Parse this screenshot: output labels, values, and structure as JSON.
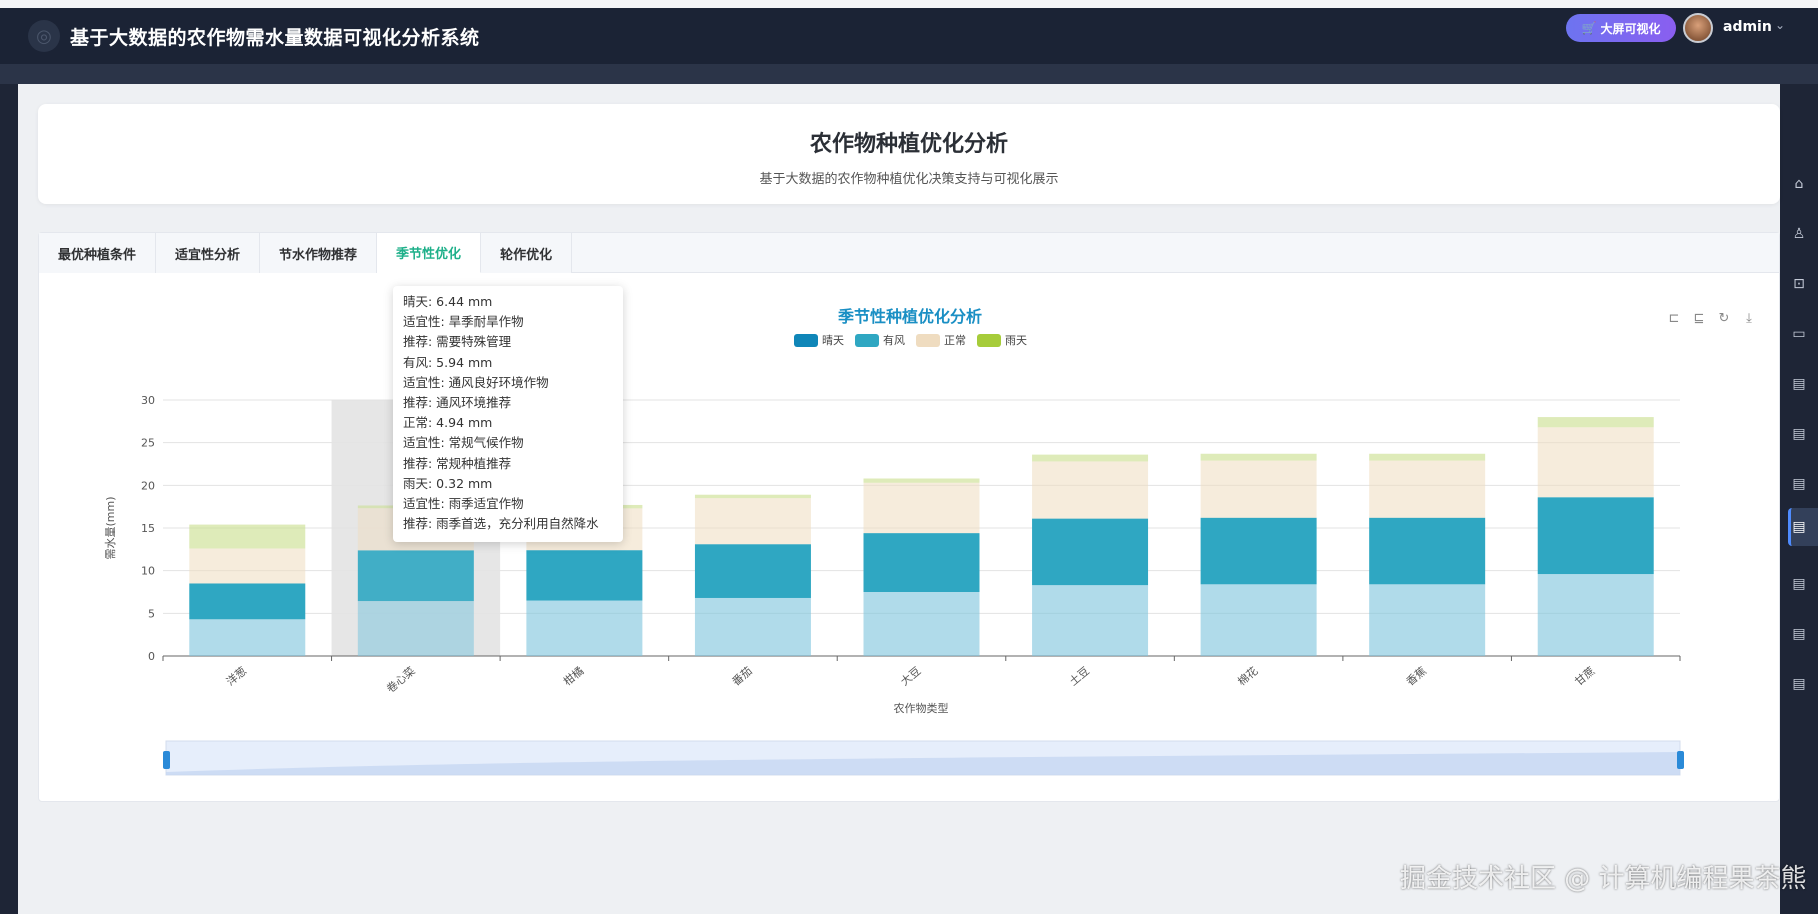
{
  "header": {
    "title": "基于大数据的农作物需水量数据可视化分析系统",
    "big_screen_label": "大屏可视化",
    "user_name": "admin"
  },
  "page": {
    "title": "农作物种植优化分析",
    "subtitle": "基于大数据的农作物种植优化决策支持与可视化展示"
  },
  "tabs": [
    {
      "label": "最优种植条件"
    },
    {
      "label": "适宜性分析"
    },
    {
      "label": "节水作物推荐"
    },
    {
      "label": "季节性优化"
    },
    {
      "label": "轮作优化"
    }
  ],
  "colors": {
    "sunny": "#0f86b8",
    "windy": "#2fa7c2",
    "normal": "#efdcc0",
    "rainy": "#a6cc3a",
    "accent": "#1fb08a",
    "chart_title": "#1a8fc4"
  },
  "chart_data": {
    "type": "bar",
    "stacked": true,
    "title": "季节性种植优化分析",
    "xlabel": "农作物类型",
    "ylabel": "需水量(mm)",
    "ylim": [
      0,
      30
    ],
    "yticks": [
      "0",
      "5",
      "10",
      "15",
      "20",
      "25",
      "30"
    ],
    "categories": [
      "洋葱",
      "卷心菜",
      "柑橘",
      "番茄",
      "大豆",
      "土豆",
      "棉花",
      "香蕉",
      "甘蔗"
    ],
    "series": [
      {
        "name": "晴天",
        "values": [
          4.3,
          6.44,
          6.5,
          6.8,
          7.5,
          8.3,
          8.4,
          8.4,
          9.6
        ]
      },
      {
        "name": "有风",
        "values": [
          4.2,
          5.94,
          5.9,
          6.3,
          6.9,
          7.8,
          7.8,
          7.8,
          9.0
        ]
      },
      {
        "name": "正常",
        "values": [
          4.1,
          4.94,
          4.9,
          5.4,
          5.9,
          6.7,
          6.7,
          6.7,
          8.2
        ]
      },
      {
        "name": "雨天",
        "values": [
          2.8,
          0.32,
          0.4,
          0.4,
          0.5,
          0.8,
          0.8,
          0.8,
          1.2
        ]
      }
    ],
    "legend_position": "top-center",
    "grid": true,
    "highlighted_category": "卷心菜"
  },
  "tooltip": {
    "lines": [
      "晴天: 6.44 mm",
      "适宜性: 旱季耐旱作物",
      "推荐: 需要特殊管理",
      "有风: 5.94 mm",
      "适宜性: 通风良好环境作物",
      "推荐: 通风环境推荐",
      "正常: 4.94 mm",
      "适宜性: 常规气候作物",
      "推荐: 常规种植推荐",
      "雨天: 0.32 mm",
      "适宜性: 雨季适宜作物",
      "推荐: 雨季首选，充分利用自然降水"
    ]
  },
  "toolbox": {
    "icons": [
      "zoom-icon",
      "zoom-reset-icon",
      "restore-icon",
      "save-image-icon"
    ]
  },
  "watermark": "掘金技术社区 @ 计算机编程果茶熊"
}
